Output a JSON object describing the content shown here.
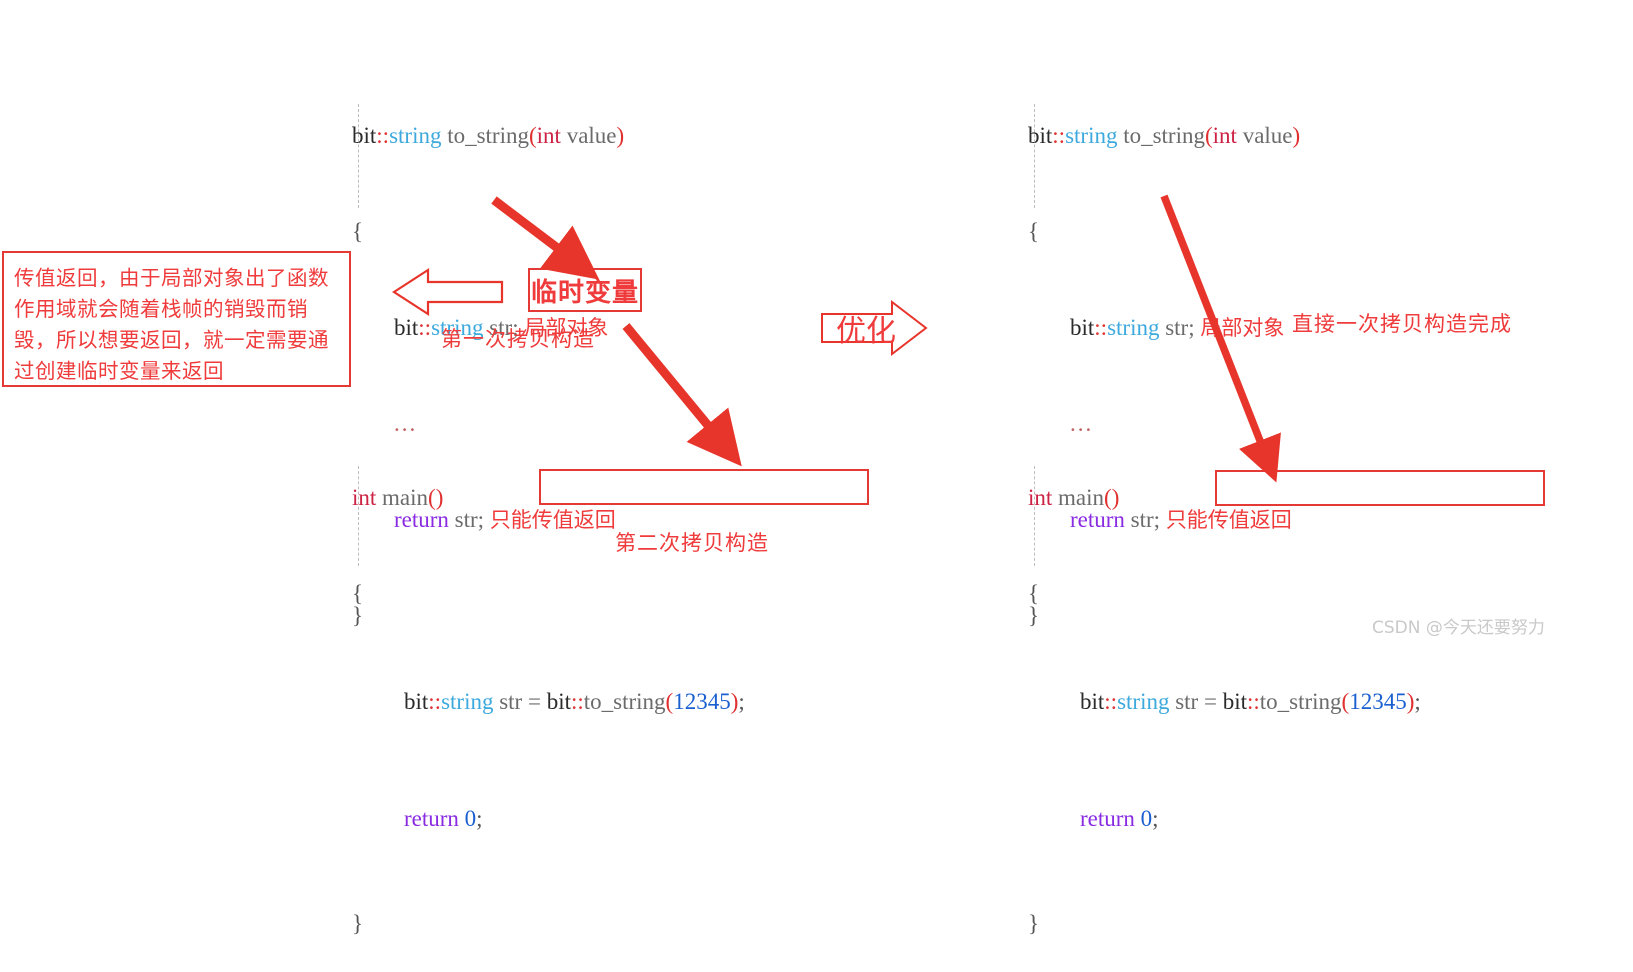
{
  "left_panel": {
    "function_code": {
      "line1": {
        "ns": "bit",
        "sep": "::",
        "cls": "string",
        "space": " ",
        "fn": "to_string",
        "paren_open": "(",
        "type": "int",
        "arg": " value",
        "paren_close": ")"
      },
      "line2": "{",
      "line3": {
        "ns": "bit",
        "sep": "::",
        "cls": "string",
        "var": " str;",
        "comment": "局部对象"
      },
      "line4": "...",
      "line5": {
        "kw": "return",
        "var": " str;",
        "comment": "只能传值返回"
      },
      "line6": "}"
    },
    "main_code": {
      "line1": {
        "type": "int",
        "fn": " main",
        "parens": "()"
      },
      "line2": "{",
      "line3": {
        "ns": "bit",
        "sep": "::",
        "cls": "string",
        "boxed": {
          "var": "str = ",
          "ns2": "bit",
          "sep2": "::",
          "fn2": "to_string",
          "paren_open": "(",
          "num": "12345",
          "paren_close": ")",
          "semi": ";"
        }
      },
      "line4": {
        "kw": "return",
        "num": " 0",
        "semi": ";"
      },
      "line5": "}"
    },
    "note_box_text": "传值返回，由于局部对象出了函数作用域就会随着栈帧的销毁而销毁，所以想要返回，就一定需要通过创建临时变量来返回",
    "temp_var_label": "临时变量",
    "first_copy_label": "第一次拷贝构造",
    "second_copy_label": "第二次拷贝构造"
  },
  "middle": {
    "optimize_label": "优化"
  },
  "right_panel": {
    "function_code": {
      "line1": {
        "ns": "bit",
        "sep": "::",
        "cls": "string",
        "space": " ",
        "fn": "to_string",
        "paren_open": "(",
        "type": "int",
        "arg": " value",
        "paren_close": ")"
      },
      "line2": "{",
      "line3": {
        "ns": "bit",
        "sep": "::",
        "cls": "string",
        "var": " str;",
        "comment": "局部对象"
      },
      "line4": "...",
      "line5": {
        "kw": "return",
        "var": " str;",
        "comment": "只能传值返回"
      },
      "line6": "}"
    },
    "main_code": {
      "line1": {
        "type": "int",
        "fn": " main",
        "parens": "()"
      },
      "line2": "{",
      "line3": {
        "ns": "bit",
        "sep": "::",
        "cls": "string",
        "boxed": {
          "var": "str = ",
          "ns2": "bit",
          "sep2": "::",
          "fn2": "to_string",
          "paren_open": "(",
          "num": "12345",
          "paren_close": ")",
          "semi": ";"
        }
      },
      "line4": {
        "kw": "return",
        "num": " 0",
        "semi": ";"
      },
      "line5": "}"
    },
    "direct_copy_label": "直接一次拷贝构造完成"
  },
  "watermark": "CSDN @今天还要努力",
  "colors": {
    "red": "#ef3b3b",
    "box_border": "#e53935",
    "arrow_red": "#e8352b",
    "class_blue": "#3da9dd",
    "number_blue": "#1a5fd0",
    "keyword_purple": "#8a2be2",
    "watermark_gray": "#c9c9c9"
  }
}
